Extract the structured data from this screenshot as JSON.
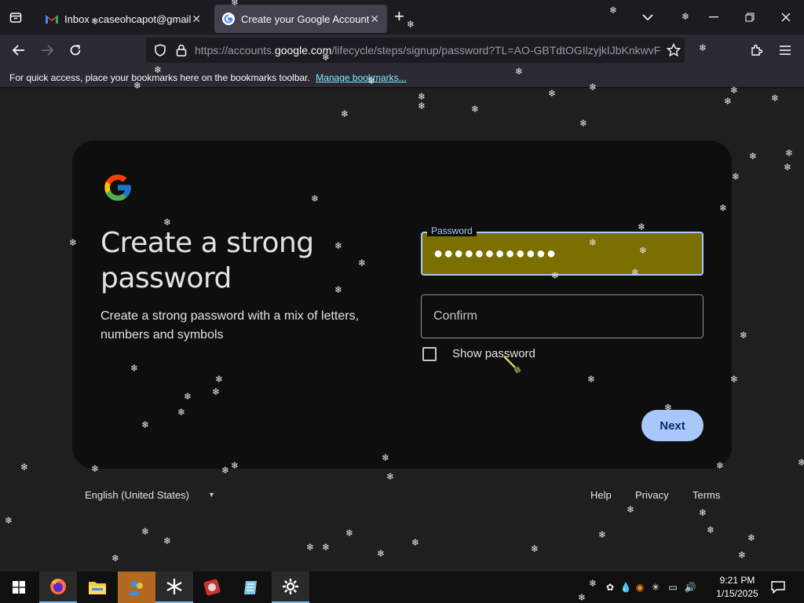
{
  "browser": {
    "tabs": [
      {
        "title": "Inbox - caseohcapot@gmail.com",
        "favicon": "gmail-icon"
      },
      {
        "title": "Create your Google Account",
        "favicon": "google-icon",
        "active": true
      }
    ],
    "url": {
      "prefix": "https://accounts.",
      "domain": "google.com",
      "suffix": "/lifecycle/steps/signup/password?TL=AO-GBTdtOGIlzyjkIJbKnkwvFN"
    },
    "bookmarks_bar": {
      "text": "For quick access, place your bookmarks here on the bookmarks toolbar.",
      "link": "Manage bookmarks..."
    }
  },
  "page": {
    "heading": "Create a strong password",
    "subtitle": "Create a strong password with a mix of letters, numbers and symbols",
    "password_field": {
      "label": "Password",
      "value": "●●●●●●●●●●●●"
    },
    "confirm_field": {
      "placeholder": "Confirm"
    },
    "show_password": {
      "label": "Show password",
      "checked": false
    },
    "next_button": "Next",
    "footer": {
      "language": "English (United States)",
      "links": [
        "Help",
        "Privacy",
        "Terms"
      ]
    }
  },
  "taskbar": {
    "clock_time": "9:21 PM",
    "clock_date": "1/15/2025"
  },
  "colors": {
    "accent": "#a8c7fa",
    "password_fill": "#7a6f00",
    "card_bg": "#0e0e0e"
  }
}
